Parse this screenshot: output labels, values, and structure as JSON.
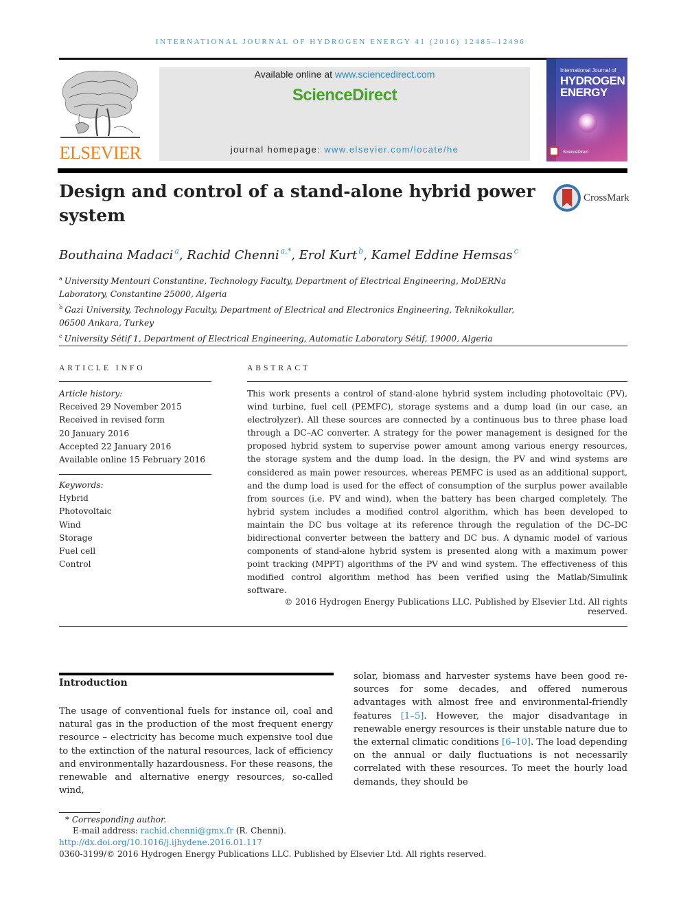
{
  "running_head": "INTERNATIONAL JOURNAL OF HYDROGEN ENERGY 41 (2016) 12485–12496",
  "header": {
    "publisher_logo": "ELSEVIER",
    "available_online_prefix": "Available online at ",
    "available_online_link": "www.sciencedirect.com",
    "brand": "ScienceDirect",
    "homepage_prefix": "journal homepage: ",
    "homepage_link": "www.elsevier.com/locate/he",
    "cover": {
      "line1": "International Journal of",
      "line2": "HYDROGEN",
      "line3": "ENERGY",
      "footer": "ScienceDirect"
    },
    "colors": {
      "link": "#2f8ac0",
      "brand_green": "#49a22a",
      "elsevier_orange": "#f07f1c",
      "running_head": "#3a9ac6"
    }
  },
  "article": {
    "title": "Design and control of a stand-alone hybrid power system",
    "crossmark_label": "CrossMark",
    "authors": [
      {
        "name": "Bouthaina Madaci",
        "sup": "a",
        "sep": ", "
      },
      {
        "name": "Rachid Chenni",
        "sup": "a,*",
        "sep": ", "
      },
      {
        "name": "Erol Kurt",
        "sup": "b",
        "sep": ", "
      },
      {
        "name": "Kamel Eddine Hemsas",
        "sup": "c",
        "sep": ""
      }
    ],
    "affiliations": [
      {
        "label": "a",
        "text": "University Mentouri Constantine, Technology Faculty, Department of Electrical Engineering, MoDERNa Laboratory, Constantine 25000, Algeria"
      },
      {
        "label": "b",
        "text": "Gazi University, Technology Faculty, Department of Electrical and Electronics Engineering, Teknikokullar, 06500 Ankara, Turkey"
      },
      {
        "label": "c",
        "text": "University Sétif 1, Department of Electrical Engineering, Automatic Laboratory Sétif, 19000, Algeria"
      }
    ]
  },
  "article_info": {
    "heading": "ARTICLE INFO",
    "history_heading": "Article history:",
    "history": [
      "Received 29 November 2015",
      "Received in revised form",
      "20 January 2016",
      "Accepted 22 January 2016",
      "Available online 15 February 2016"
    ],
    "keywords_heading": "Keywords:",
    "keywords": [
      "Hybrid",
      "Photovoltaic",
      "Wind",
      "Storage",
      "Fuel cell",
      "Control"
    ]
  },
  "abstract": {
    "heading": "ABSTRACT",
    "text": "This work presents a control of stand-alone hybrid system including photovoltaic (PV), wind turbine, fuel cell (PEMFC), storage systems and a dump load (in our case, an electrolyzer). All these sources are connected by a continuous bus to three phase load through a DC–AC converter. A strategy for the power management is designed for the proposed hybrid system to supervise power amount among various energy resources, the storage system and the dump load. In the design, the PV and wind systems are considered as main power resources, whereas PEMFC is used as an additional support, and the dump load is used for the effect of consumption of the surplus power available from sources (i.e. PV and wind), when the battery has been charged completely. The hybrid system includes a modified control algorithm, which has been developed to maintain the DC bus voltage at its reference through the regulation of the DC–DC bidirectional converter between the battery and DC bus. A dynamic model of various components of stand-alone hybrid system is presented along with a maximum power point tracking (MPPT) algorithms of the PV and wind system. The effectiveness of this modified control algorithm method has been verified using the Matlab/Simulink software.",
    "copyright": "© 2016 Hydrogen Energy Publications LLC. Published by Elsevier Ltd. All rights reserved."
  },
  "introduction": {
    "heading": "Introduction",
    "left_text": "The usage of conventional fuels for instance oil, coal and natural gas in the production of the most frequent energy resource – electricity has become much expensive tool due to the extinction of the natural resources, lack of efficiency and environmentally hazardousness. For these reasons, the renewable and alternative energy resources, so-called wind,",
    "right_parts": [
      {
        "t": "solar, biomass and harvester systems have been good re­sources for some decades, and offered numerous advantages with almost free and environmental-friendly features "
      },
      {
        "ref": "[1–5]"
      },
      {
        "t": ". However, the major disadvantage in renewable energy re­sources is their unstable nature due to the external climatic conditions "
      },
      {
        "ref": "[6–10]"
      },
      {
        "t": ". The load depending on the annual or daily fluctuations is not necessarily correlated with these re­sources. To meet the hourly load demands, they should be"
      }
    ]
  },
  "footnotes": {
    "corresponding": "* Corresponding author.",
    "email_prefix": "E-mail address: ",
    "email": "rachid.chenni@gmx.fr",
    "email_suffix": " (R. Chenni).",
    "doi": "http://dx.doi.org/10.1016/j.ijhydene.2016.01.117",
    "issn_copyright": "0360-3199/© 2016 Hydrogen Energy Publications LLC. Published by Elsevier Ltd. All rights reserved."
  }
}
